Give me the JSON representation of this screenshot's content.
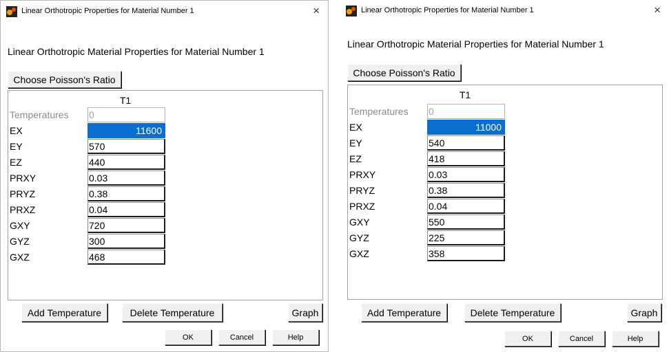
{
  "dialogs": [
    {
      "window_title": "Linear Orthotropic Properties for Material Number 1",
      "close_glyph": "×",
      "heading": "Linear Orthotropic Material Properties for Material Number 1",
      "poisson_button": "Choose Poisson's Ratio",
      "column_header": "T1",
      "rows": [
        {
          "label": "Temperatures",
          "value": "0"
        },
        {
          "label": "EX",
          "value": "11600"
        },
        {
          "label": "EY",
          "value": "570"
        },
        {
          "label": "EZ",
          "value": "440"
        },
        {
          "label": "PRXY",
          "value": "0.03"
        },
        {
          "label": "PRYZ",
          "value": "0.38"
        },
        {
          "label": "PRXZ",
          "value": "0.04"
        },
        {
          "label": "GXY",
          "value": "720"
        },
        {
          "label": "GYZ",
          "value": "300"
        },
        {
          "label": "GXZ",
          "value": "468"
        }
      ],
      "buttons": {
        "add_temperature": "Add Temperature",
        "delete_temperature": "Delete Temperature",
        "graph": "Graph",
        "ok": "OK",
        "cancel": "Cancel",
        "help": "Help"
      }
    },
    {
      "window_title": "Linear Orthotropic Properties for Material Number 1",
      "close_glyph": "×",
      "heading": "Linear Orthotropic Material Properties for Material Number 1",
      "poisson_button": "Choose Poisson's Ratio",
      "column_header": "T1",
      "rows": [
        {
          "label": "Temperatures",
          "value": "0"
        },
        {
          "label": "EX",
          "value": "11000"
        },
        {
          "label": "EY",
          "value": "540"
        },
        {
          "label": "EZ",
          "value": "418"
        },
        {
          "label": "PRXY",
          "value": "0.03"
        },
        {
          "label": "PRYZ",
          "value": "0.38"
        },
        {
          "label": "PRXZ",
          "value": "0.04"
        },
        {
          "label": "GXY",
          "value": "550"
        },
        {
          "label": "GYZ",
          "value": "225"
        },
        {
          "label": "GXZ",
          "value": "358"
        }
      ],
      "buttons": {
        "add_temperature": "Add Temperature",
        "delete_temperature": "Delete Temperature",
        "graph": "Graph",
        "ok": "OK",
        "cancel": "Cancel",
        "help": "Help"
      }
    }
  ],
  "icons": {
    "app": "ansys-material-icon",
    "close": "close-icon"
  },
  "colors": {
    "selected_cell": "#0a6ed1",
    "disabled_text": "#8c8c8c"
  }
}
